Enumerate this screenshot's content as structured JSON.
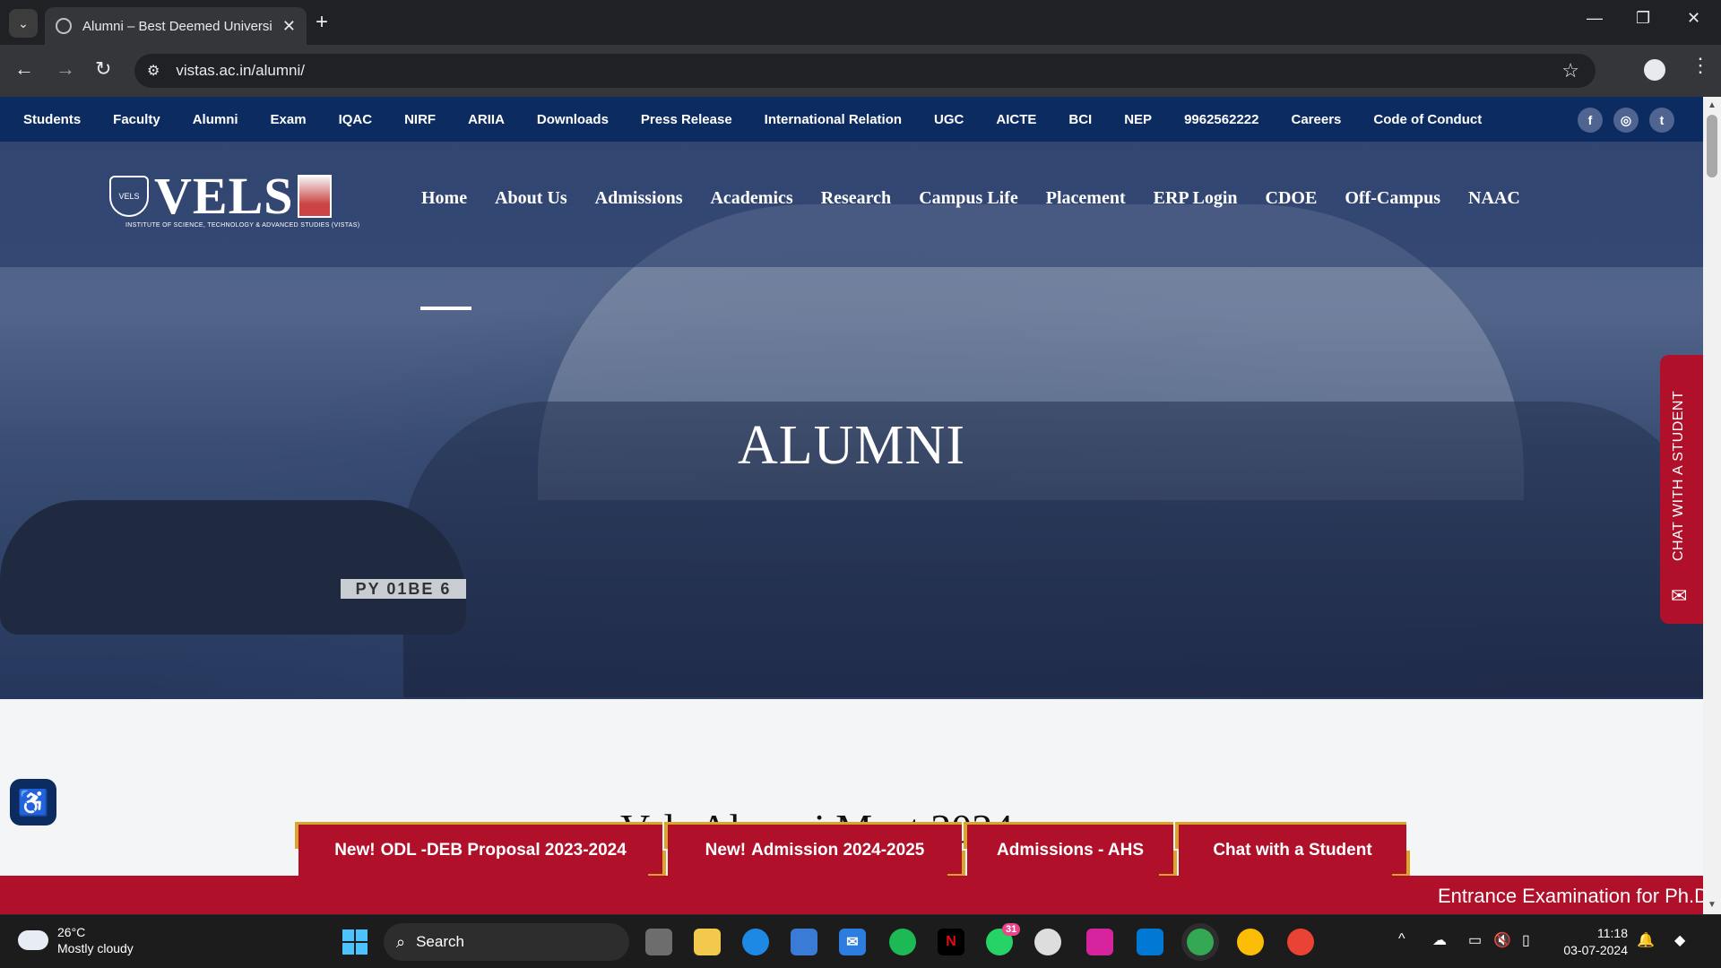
{
  "browser": {
    "tab_title": "Alumni – Best Deemed Universi",
    "url": "vistas.ac.in/alumni/"
  },
  "topbar": {
    "links": [
      "Students",
      "Faculty",
      "Alumni",
      "Exam",
      "IQAC",
      "NIRF",
      "ARIIA",
      "Downloads",
      "Press Release",
      "International Relation",
      "UGC",
      "AICTE",
      "BCI",
      "NEP",
      "9962562222",
      "Careers",
      "Code of Conduct"
    ],
    "social": [
      "f",
      "◎",
      "t"
    ]
  },
  "logo": {
    "word": "VELS",
    "crest": "VELS",
    "subtitle": "INSTITUTE OF SCIENCE, TECHNOLOGY & ADVANCED STUDIES (VISTAS)"
  },
  "mainnav": {
    "items": [
      "Home",
      "About Us",
      "Admissions",
      "Academics",
      "Research",
      "Campus Life",
      "Placement",
      "ERP Login",
      "CDOE",
      "Off-Campus",
      "NAAC"
    ],
    "active": "Home"
  },
  "hero": {
    "title": "ALUMNI",
    "plate": "PY 01BE 6"
  },
  "chat_tab": {
    "label": "CHAT WITH A STUDENT"
  },
  "section": {
    "heading": "Vels Alumni Meet 2024"
  },
  "buttons": [
    {
      "prefix": "New!",
      "label": "ODL -DEB Proposal 2023-2024"
    },
    {
      "prefix": "New!",
      "label": "Admission 2024-2025"
    },
    {
      "prefix": "",
      "label": "Admissions - AHS"
    },
    {
      "prefix": "",
      "label": "Chat with a Student"
    }
  ],
  "ticker": {
    "text": "Entrance Examination for Ph.D"
  },
  "taskbar": {
    "weather_temp": "26°C",
    "weather_desc": "Mostly cloudy",
    "search_placeholder": "Search",
    "whatsapp_badge": "31",
    "time": "11:18",
    "date": "03-07-2024"
  },
  "colors": {
    "navy": "#0c2b60",
    "crimson": "#b0102a",
    "gold": "#d9a62b"
  }
}
